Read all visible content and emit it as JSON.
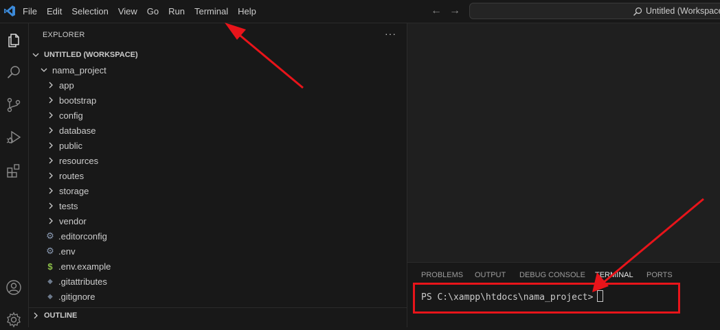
{
  "menu": [
    "File",
    "Edit",
    "Selection",
    "View",
    "Go",
    "Run",
    "Terminal",
    "Help"
  ],
  "search": {
    "label": "Untitled (Workspace)"
  },
  "sidebar": {
    "title": "EXPLORER",
    "workspace": "UNTITLED (WORKSPACE)",
    "project": "nama_project",
    "folders": [
      "app",
      "bootstrap",
      "config",
      "database",
      "public",
      "resources",
      "routes",
      "storage",
      "tests",
      "vendor"
    ],
    "files": [
      {
        "name": ".editorconfig",
        "icon": "gear-icon"
      },
      {
        "name": ".env",
        "icon": "gear-icon"
      },
      {
        "name": ".env.example",
        "icon": "dollar-icon"
      },
      {
        "name": ".gitattributes",
        "icon": "git-icon"
      },
      {
        "name": ".gitignore",
        "icon": "git-icon"
      }
    ],
    "outline": "OUTLINE"
  },
  "panel": {
    "tabs": [
      "PROBLEMS",
      "OUTPUT",
      "DEBUG CONSOLE",
      "TERMINAL",
      "PORTS"
    ],
    "active_tab": "TERMINAL",
    "terminal_prompt": "PS C:\\xampp\\htdocs\\nama_project>"
  },
  "colors": {
    "background": "#181818",
    "editor": "#1f1f1f",
    "accent_blue": "#3c8ad9",
    "annotation_red": "#e8141a"
  }
}
